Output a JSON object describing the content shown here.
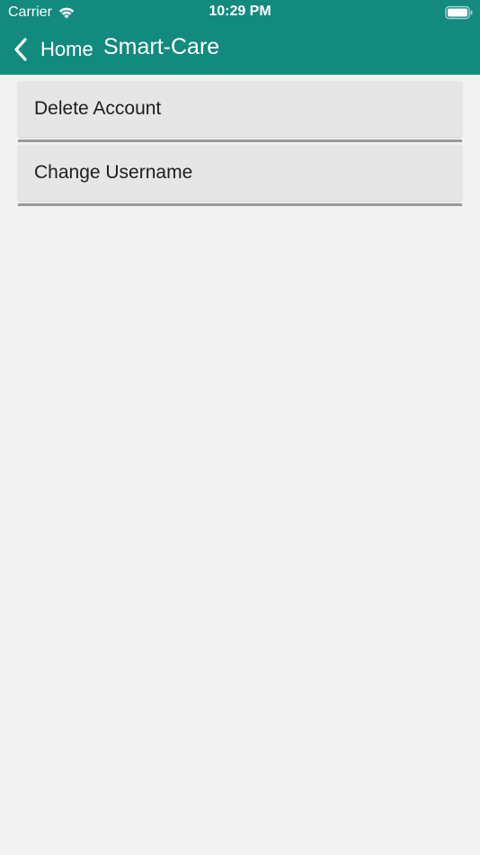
{
  "status_bar": {
    "carrier": "Carrier",
    "time": "10:29 PM",
    "wifi_icon": "wifi-icon",
    "battery_icon": "battery-icon"
  },
  "nav": {
    "back_label": "Home",
    "back_icon": "chevron-left-icon",
    "title": "Smart-Care"
  },
  "menu": {
    "items": [
      {
        "label": "Delete Account"
      },
      {
        "label": "Change Username"
      }
    ]
  },
  "colors": {
    "header": "#138a7e",
    "background": "#f2f2f2",
    "item_background": "#e6e6e6",
    "divider": "#9a9a9a"
  }
}
